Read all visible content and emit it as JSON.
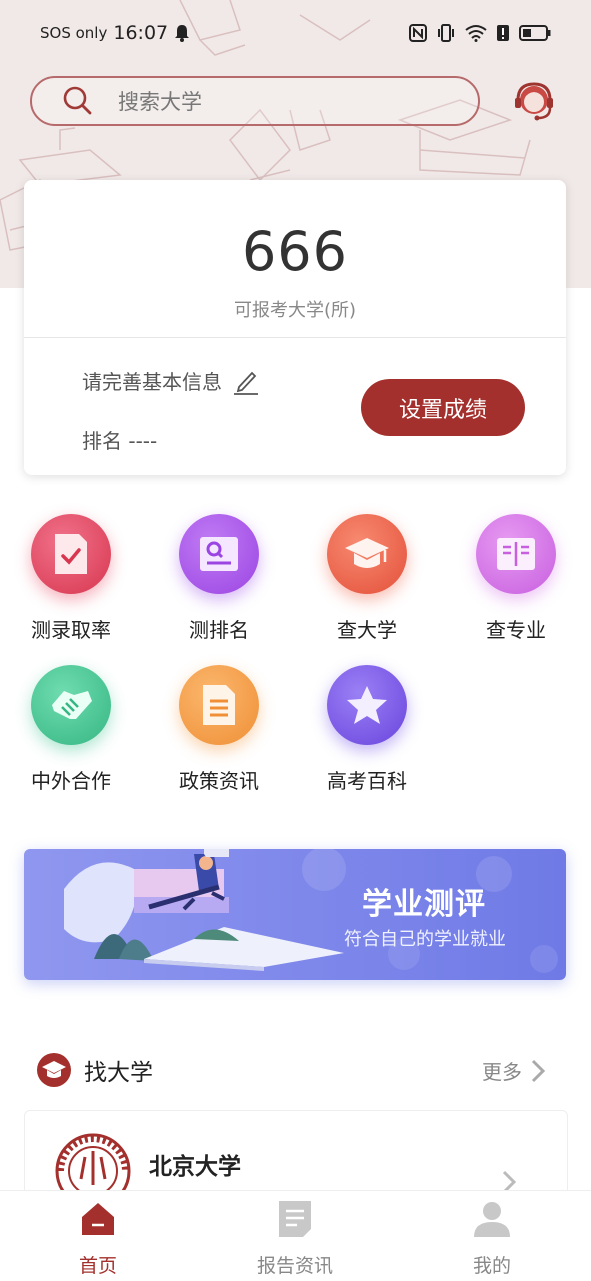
{
  "status_bar": {
    "network_text": "SOS only",
    "time": "16:07",
    "icons": [
      "bell-icon",
      "nfc-icon",
      "vibrate-icon",
      "wifi-icon",
      "alert-icon",
      "battery-icon"
    ]
  },
  "search": {
    "placeholder": "搜索大学",
    "icon": "search-icon"
  },
  "customer_service": {
    "icon": "headset-avatar-icon"
  },
  "score_card": {
    "count": "666",
    "count_label": "可报考大学(所)",
    "info_prompt": "请完善基本信息",
    "rank_text": "排名 ----",
    "set_score_button": "设置成绩"
  },
  "feature_grid": [
    {
      "label": "测录取率",
      "icon": "document-check-icon",
      "color": "#e8536b"
    },
    {
      "label": "测排名",
      "icon": "search-document-icon",
      "color": "#a45bea"
    },
    {
      "label": "查大学",
      "icon": "graduation-cap-icon",
      "color": "#f06a4f"
    },
    {
      "label": "查专业",
      "icon": "open-book-icon",
      "color": "#d67be8"
    },
    {
      "label": "中外合作",
      "icon": "handshake-icon",
      "color": "#4cc79a"
    },
    {
      "label": "政策资讯",
      "icon": "document-list-icon",
      "color": "#f5a04e"
    },
    {
      "label": "高考百科",
      "icon": "star-icon",
      "color": "#7a58e8"
    }
  ],
  "banner": {
    "title": "学业测评",
    "subtitle": "符合自己的学业就业"
  },
  "find_university": {
    "title": "找大学",
    "more": "更多",
    "first_item": "北京大学"
  },
  "bottom_nav": [
    {
      "label": "首页",
      "icon": "home-icon",
      "active": true
    },
    {
      "label": "报告资讯",
      "icon": "report-icon",
      "active": false
    },
    {
      "label": "我的",
      "icon": "person-icon",
      "active": false
    }
  ],
  "colors": {
    "primary": "#a3302c",
    "hero_bg": "#f1e9e8",
    "nav_active": "#a3302c",
    "nav_inactive": "#888888"
  }
}
